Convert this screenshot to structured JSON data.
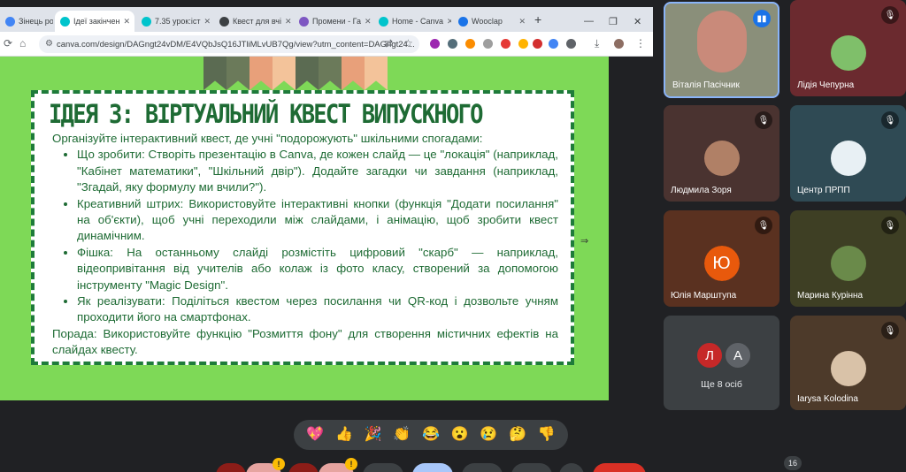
{
  "browser": {
    "tabs": [
      {
        "label": "Зінець ронь",
        "favicon_color": "#4285f4"
      },
      {
        "label": "Ідеї закінчен",
        "favicon_color": "#00c4cc"
      },
      {
        "label": "7.35 урок:іст",
        "favicon_color": "#00c4cc"
      },
      {
        "label": "Квест для вчі",
        "favicon_color": "#3c4043"
      },
      {
        "label": "Промени - Га",
        "favicon_color": "#7e57c2"
      },
      {
        "label": "Home - Canva",
        "favicon_color": "#00c4cc"
      },
      {
        "label": "Wooclap",
        "favicon_color": "#1a73e8"
      }
    ],
    "url": "canva.com/design/DAGngt24vDM/E4VQbJsQ16JTliMLvUB7Qg/view?utm_content=DAGngt24..."
  },
  "slide": {
    "title": "ІДЕЯ 3: ВІРТУАЛЬНИЙ КВЕСТ ВИПУСКНОГО",
    "intro": "Організуйте інтерактивний квест, де учні \"подорожують\" шкільними спогадами:",
    "bullets": [
      "Що зробити: Створіть презентацію в Canva, де кожен слайд — це \"локація\" (наприклад, \"Кабінет математики\", \"Шкільний двір\"). Додайте загадки чи завдання (наприклад, \"Згадай, яку формулу ми вчили?\").",
      "Креативний штрих: Використовуйте інтерактивні кнопки (функція \"Додати посилання\" на об'єкти), щоб учні переходили між слайдами, і анімацію, щоб зробити квест динамічним.",
      "Фішка: На останньому слайді розмістіть цифровий \"скарб\" — наприклад, відеопривітання від учителів або колаж із фото класу, створений за допомогою інструменту \"Magic Design\".",
      "Як реалізувати: Поділіться квестом через посилання чи QR-код і дозвольте учням проходити його на смартфонах."
    ],
    "tip": "Порада: Використовуйте функцію \"Розмиття фону\" для створення містичних ефектів на слайдах квесту."
  },
  "participants": [
    {
      "name": "Віталія Пасічник",
      "bg": "#8a8f7a",
      "avatar_color": "#c98a7a"
    },
    {
      "name": "Лідія Чепурна",
      "bg": "#6b2a2f",
      "avatar_color": "#7fbf6a"
    },
    {
      "name": "Людмила Зоря",
      "bg": "#4a3330",
      "avatar_color": "#b08066"
    },
    {
      "name": "Центр ПРПП",
      "bg": "#2f4a54",
      "avatar_color": "#e8f0f4"
    },
    {
      "name": "Юлія Марштупа",
      "bg": "#5a3120",
      "avatar_letter": "Ю",
      "avatar_color": "#e8590c"
    },
    {
      "name": "Марина Курінна",
      "bg": "#3e3f24",
      "avatar_color": "#6a8a4a"
    },
    {
      "name": "Iarysa Kolodina",
      "bg": "#4d3a2a",
      "avatar_color": "#d9c2a8"
    }
  ],
  "more": {
    "label": "Ще 8 осіб",
    "letters": [
      "Л",
      "А"
    ],
    "colors": [
      "#c62828",
      "#5f6368"
    ]
  },
  "reactions": [
    "💖",
    "👍",
    "🎉",
    "👏",
    "😂",
    "😮",
    "😢",
    "🤔",
    "👎"
  ],
  "participant_count": "16"
}
